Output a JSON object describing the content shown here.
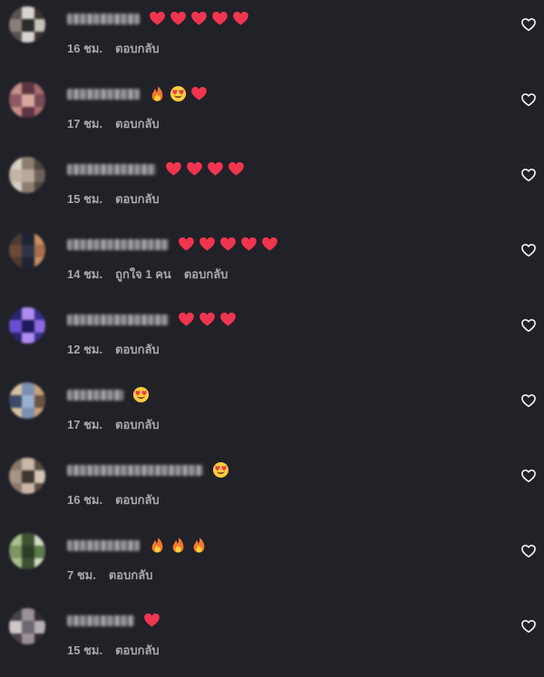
{
  "comments": [
    {
      "username": "",
      "name_width": 80,
      "emojis": [
        "red-heart",
        "red-heart",
        "red-heart",
        "red-heart",
        "red-heart"
      ],
      "time": "16 ชม.",
      "likes": "",
      "reply": "ตอบกลับ",
      "avatar_colors": [
        "#5a5252",
        "#d8d4d2",
        "#3a3433",
        "#8a7f7a",
        "#2e2a29",
        "#c9c1bb"
      ]
    },
    {
      "username": "",
      "name_width": 80,
      "emojis": [
        "fire",
        "heart-eyes",
        "red-heart"
      ],
      "time": "17 ชม.",
      "likes": "",
      "reply": "ตอบกลับ",
      "avatar_colors": [
        "#7a4a55",
        "#c98f8a",
        "#5d3541",
        "#a86b70",
        "#8d5a63",
        "#d9a9a0"
      ]
    },
    {
      "username": "",
      "name_width": 98,
      "emojis": [
        "red-heart",
        "red-heart",
        "red-heart",
        "red-heart"
      ],
      "time": "15 ชม.",
      "likes": "",
      "reply": "ตอบกลับ",
      "avatar_colors": [
        "#b9a99a",
        "#6e6258",
        "#d9cfc4",
        "#8c7d70",
        "#4e453f",
        "#c2b5a8"
      ]
    },
    {
      "username": "",
      "name_width": 112,
      "emojis": [
        "red-heart",
        "red-heart",
        "red-heart",
        "red-heart",
        "red-heart"
      ],
      "time": "14 ชม.",
      "likes": "ถูกใจ 1 คน",
      "reply": "ตอบกลับ",
      "avatar_colors": [
        "#6b4a3a",
        "#2e3446",
        "#a8704f",
        "#4c3a33",
        "#1f2433",
        "#c98d63"
      ]
    },
    {
      "username": "",
      "name_width": 112,
      "emojis": [
        "red-heart",
        "red-heart",
        "red-heart"
      ],
      "time": "12 ชม.",
      "likes": "",
      "reply": "ตอบกลับ",
      "avatar_colors": [
        "#3a2f8f",
        "#6a4fd0",
        "#1c1a5a",
        "#8c6be0",
        "#2a2470",
        "#b08cf0"
      ]
    },
    {
      "username": "",
      "name_width": 62,
      "emojis": [
        "heart-eyes"
      ],
      "time": "17 ชม.",
      "likes": "",
      "reply": "ตอบกลับ",
      "avatar_colors": [
        "#7c8fb0",
        "#c7a27a",
        "#3b4a66",
        "#9bb0cf",
        "#6b5440",
        "#d8c2a4"
      ]
    },
    {
      "username": "",
      "name_width": 150,
      "emojis": [
        "heart-eyes"
      ],
      "time": "16 ชม.",
      "likes": "",
      "reply": "ตอบกลับ",
      "avatar_colors": [
        "#8a7a6c",
        "#c9b8a7",
        "#5b4f45",
        "#a89484",
        "#3e3630",
        "#d6c6b6"
      ]
    },
    {
      "username": "",
      "name_width": 80,
      "emojis": [
        "fire",
        "fire",
        "fire"
      ],
      "time": "7 ชม.",
      "likes": "",
      "reply": "ตอบกลับ",
      "avatar_colors": [
        "#5f7a4d",
        "#a9c08c",
        "#3d5232",
        "#d4dcc2",
        "#7d9466",
        "#2e3d27"
      ]
    },
    {
      "username": "",
      "name_width": 74,
      "emojis": [
        "red-heart"
      ],
      "time": "15 ชม.",
      "likes": "",
      "reply": "ตอบกลับ",
      "avatar_colors": [
        "#6c6670",
        "#b8b0b4",
        "#48424a",
        "#9a9096",
        "#2f2b31",
        "#cfc7ca"
      ]
    }
  ],
  "colors": {
    "background": "#212128",
    "meta_text": "#a8a8ae",
    "heart_outline": "#ffffff",
    "emoji_heart": "#f0354f"
  }
}
